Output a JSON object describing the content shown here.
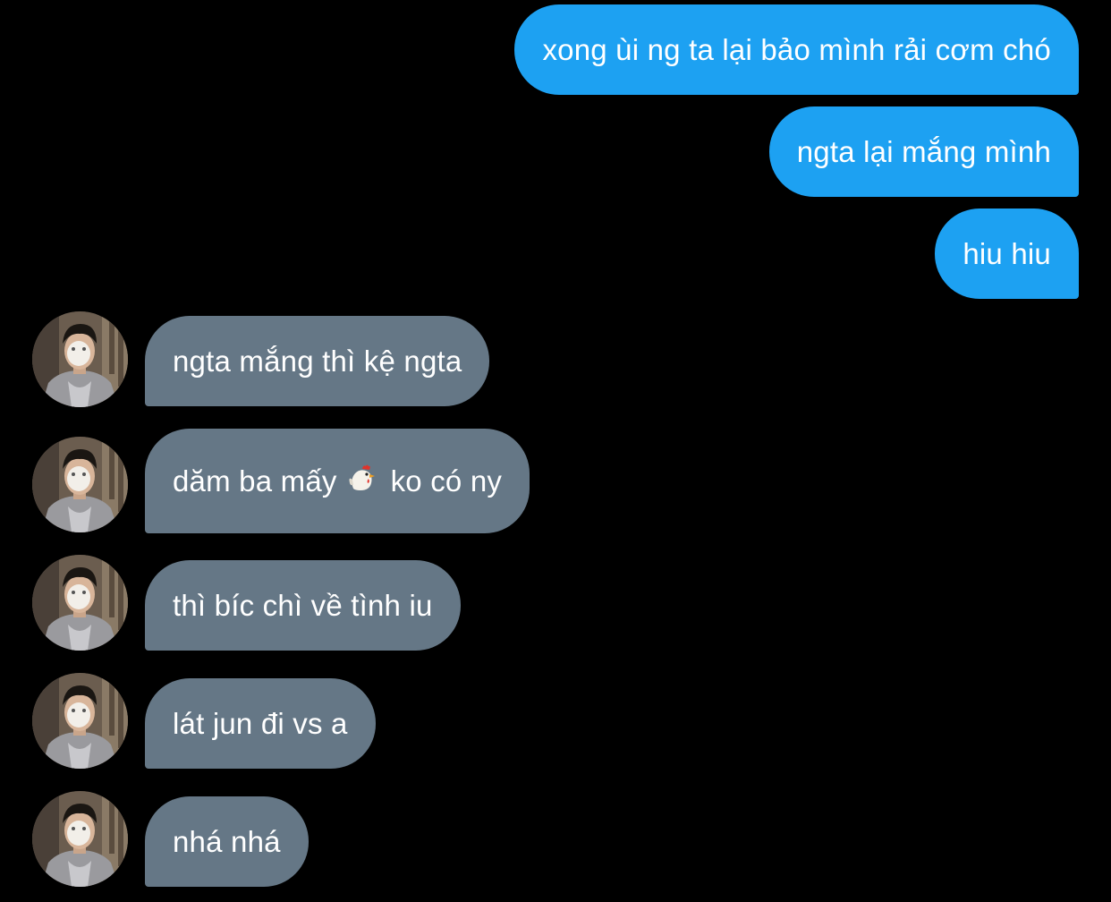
{
  "conversation": {
    "sent_messages": [
      {
        "text": "xong ùi ng ta lại bảo mình rải cơm chó"
      },
      {
        "text": "ngta lại mắng mình"
      },
      {
        "text": "hiu hiu"
      }
    ],
    "received_messages": [
      {
        "text": "ngta mắng thì kệ ngta"
      },
      {
        "text_before": "dăm ba mấy",
        "emoji": "chicken-emoji",
        "text_after": "ko có ny"
      },
      {
        "text": "thì bíc chì về tình iu"
      },
      {
        "text": "lát jun đi vs a"
      },
      {
        "text": "nhá nhá"
      }
    ]
  },
  "colors": {
    "background": "#000000",
    "sent_bubble": "#1da1f2",
    "received_bubble": "#657786",
    "text": "#ffffff"
  }
}
